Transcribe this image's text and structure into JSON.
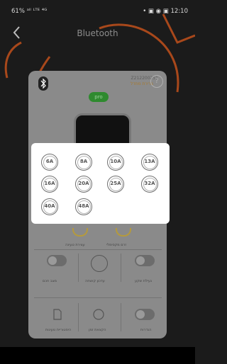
{
  "status_bar": {
    "left": "61% ᵃˡˡ ᴸᵀᴱ ⁴ᴳ",
    "right": "• ▣ ◉ ▣ 12:10"
  },
  "header": {
    "title": "Bluetooth"
  },
  "device": {
    "serial": "Z212200251",
    "serial_sub": "ברירת מחדל",
    "status_pill": "pro",
    "help": "?"
  },
  "amp_options": [
    "6A",
    "8A",
    "10A",
    "13A",
    "16A",
    "20A",
    "25A",
    "32A",
    "40A",
    "48A"
  ],
  "labels": {
    "mid_left": "עצירת טעינה",
    "mid_right": "זרם מקסימלי",
    "toggle_left": "מצב חכם",
    "toggle_center": "עדכון קושחה",
    "toggle_right": "נעילת שקע",
    "bottom_left": "היסטוריית טעינות",
    "bottom_center": "הקצאת זמן",
    "bottom_right": "הגדרות"
  },
  "icons": {
    "back": "chevron-left-icon",
    "bluetooth": "bluetooth-icon"
  },
  "colors": {
    "accent_orange": "#c8551f",
    "status_green": "#2f8a2f"
  }
}
